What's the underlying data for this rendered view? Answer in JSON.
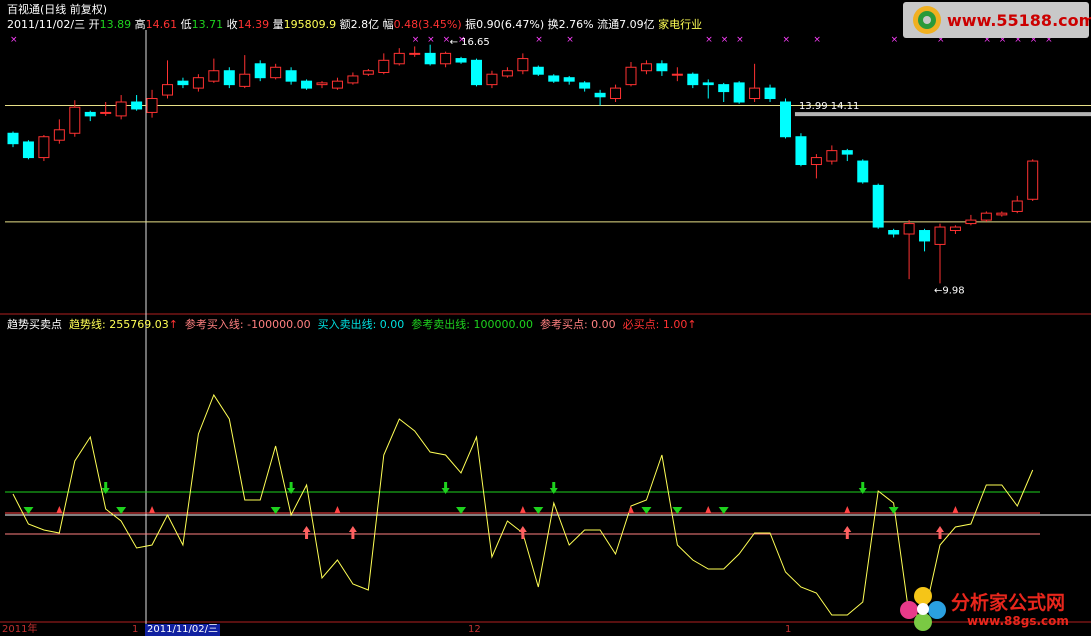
{
  "window": {
    "title": "百视通(日线 前复权)"
  },
  "quote": {
    "date": "2011/11/02/三",
    "open_label": "开",
    "open": "13.89",
    "high_label": "高",
    "high": "14.61",
    "low_label": "低",
    "low": "13.71",
    "close_label": "收",
    "close": "14.39",
    "vol_label": "量",
    "vol": "195809.9",
    "amount_label": "额",
    "amount": "2.8亿",
    "change_label": "幅",
    "change": "0.48(3.45%)",
    "amp_label": "振",
    "amp": "0.90(6.47%)",
    "turn_label": "换",
    "turn": "2.76%",
    "float_label": "流通",
    "float": "7.09亿",
    "industry": "家电行业"
  },
  "indicator": {
    "name": "趋势买卖点",
    "l1": "趋势线: 255769.03",
    "a1": "↑",
    "l2": "参考买入线: -100000.00",
    "l3": "买入卖出线: 0.00",
    "l4": "参考卖出线: 100000.00",
    "l5": "参考买点: 0.00",
    "l6": "必买点: 1.00",
    "a6": "↑"
  },
  "logos": {
    "top": "www.55188.com",
    "bottom_line1": "分析家公式网",
    "bottom_line2": "www.88gs.com"
  },
  "xaxis": {
    "labels": [
      "2011年",
      "1",
      "2011/11/02/三",
      "12",
      "1"
    ]
  },
  "colors": {
    "up": "#ff3232",
    "down": "#00ffff",
    "yellow": "#ffff55",
    "green": "#1ed21e",
    "red": "#ff4444",
    "pink": "#ff8080",
    "magenta": "#ff40ff"
  },
  "chart_data": {
    "type": "candlestick",
    "price_annotations": {
      "high_label": "16.65",
      "low_label": "9.98",
      "level_label": "13.99 14.11"
    },
    "price_ylim": [
      9.5,
      17.1
    ],
    "candles": [
      {
        "o": 14.3,
        "c": 14.0,
        "h": 14.35,
        "l": 13.9
      },
      {
        "o": 14.05,
        "c": 13.6,
        "h": 14.1,
        "l": 13.55
      },
      {
        "o": 13.6,
        "c": 14.2,
        "h": 14.25,
        "l": 13.5
      },
      {
        "o": 14.1,
        "c": 14.4,
        "h": 14.7,
        "l": 14.0
      },
      {
        "o": 14.3,
        "c": 15.05,
        "h": 15.25,
        "l": 14.2
      },
      {
        "o": 14.9,
        "c": 14.8,
        "h": 14.95,
        "l": 14.65
      },
      {
        "o": 14.9,
        "c": 14.9,
        "h": 15.2,
        "l": 14.8
      },
      {
        "o": 14.8,
        "c": 15.2,
        "h": 15.4,
        "l": 14.7
      },
      {
        "o": 15.2,
        "c": 15.0,
        "h": 15.4,
        "l": 14.95
      },
      {
        "o": 14.9,
        "c": 15.3,
        "h": 15.55,
        "l": 14.75
      },
      {
        "o": 15.4,
        "c": 15.7,
        "h": 16.4,
        "l": 15.3
      },
      {
        "o": 15.8,
        "c": 15.7,
        "h": 15.9,
        "l": 15.6
      },
      {
        "o": 15.6,
        "c": 15.9,
        "h": 16.0,
        "l": 15.5
      },
      {
        "o": 15.8,
        "c": 16.1,
        "h": 16.45,
        "l": 15.75
      },
      {
        "o": 16.1,
        "c": 15.7,
        "h": 16.2,
        "l": 15.6
      },
      {
        "o": 15.65,
        "c": 16.0,
        "h": 16.55,
        "l": 15.6
      },
      {
        "o": 16.3,
        "c": 15.9,
        "h": 16.4,
        "l": 15.8
      },
      {
        "o": 15.9,
        "c": 16.2,
        "h": 16.3,
        "l": 15.85
      },
      {
        "o": 16.1,
        "c": 15.8,
        "h": 16.2,
        "l": 15.7
      },
      {
        "o": 15.8,
        "c": 15.6,
        "h": 15.85,
        "l": 15.55
      },
      {
        "o": 15.7,
        "c": 15.75,
        "h": 15.8,
        "l": 15.6
      },
      {
        "o": 15.6,
        "c": 15.8,
        "h": 15.9,
        "l": 15.55
      },
      {
        "o": 15.75,
        "c": 15.95,
        "h": 16.05,
        "l": 15.7
      },
      {
        "o": 16.0,
        "c": 16.1,
        "h": 16.15,
        "l": 15.95
      },
      {
        "o": 16.05,
        "c": 16.4,
        "h": 16.6,
        "l": 16.0
      },
      {
        "o": 16.3,
        "c": 16.6,
        "h": 16.75,
        "l": 16.25
      },
      {
        "o": 16.6,
        "c": 16.6,
        "h": 16.8,
        "l": 16.5
      },
      {
        "o": 16.6,
        "c": 16.3,
        "h": 16.85,
        "l": 16.25
      },
      {
        "o": 16.3,
        "c": 16.6,
        "h": 16.65,
        "l": 16.2
      },
      {
        "o": 16.45,
        "c": 16.35,
        "h": 16.5,
        "l": 16.3
      },
      {
        "o": 16.4,
        "c": 15.7,
        "h": 16.45,
        "l": 15.65
      },
      {
        "o": 15.7,
        "c": 16.0,
        "h": 16.1,
        "l": 15.6
      },
      {
        "o": 15.95,
        "c": 16.1,
        "h": 16.2,
        "l": 15.9
      },
      {
        "o": 16.1,
        "c": 16.45,
        "h": 16.6,
        "l": 16.0
      },
      {
        "o": 16.2,
        "c": 16.0,
        "h": 16.25,
        "l": 15.95
      },
      {
        "o": 15.95,
        "c": 15.8,
        "h": 16.0,
        "l": 15.75
      },
      {
        "o": 15.9,
        "c": 15.8,
        "h": 15.95,
        "l": 15.7
      },
      {
        "o": 15.75,
        "c": 15.6,
        "h": 15.8,
        "l": 15.5
      },
      {
        "o": 15.45,
        "c": 15.35,
        "h": 15.55,
        "l": 15.1
      },
      {
        "o": 15.3,
        "c": 15.6,
        "h": 15.7,
        "l": 15.2
      },
      {
        "o": 15.7,
        "c": 16.2,
        "h": 16.35,
        "l": 15.65
      },
      {
        "o": 16.1,
        "c": 16.3,
        "h": 16.4,
        "l": 16.0
      },
      {
        "o": 16.3,
        "c": 16.1,
        "h": 16.4,
        "l": 15.95
      },
      {
        "o": 16.0,
        "c": 16.0,
        "h": 16.2,
        "l": 15.8
      },
      {
        "o": 16.0,
        "c": 15.7,
        "h": 16.05,
        "l": 15.6
      },
      {
        "o": 15.75,
        "c": 15.7,
        "h": 15.85,
        "l": 15.3
      },
      {
        "o": 15.7,
        "c": 15.5,
        "h": 15.75,
        "l": 15.2
      },
      {
        "o": 15.75,
        "c": 15.2,
        "h": 15.8,
        "l": 15.15
      },
      {
        "o": 15.3,
        "c": 15.6,
        "h": 16.3,
        "l": 15.2
      },
      {
        "o": 15.6,
        "c": 15.3,
        "h": 15.7,
        "l": 15.2
      },
      {
        "o": 15.2,
        "c": 14.2,
        "h": 15.3,
        "l": 14.15
      },
      {
        "o": 14.2,
        "c": 13.4,
        "h": 14.3,
        "l": 13.35
      },
      {
        "o": 13.4,
        "c": 13.6,
        "h": 13.7,
        "l": 13.0
      },
      {
        "o": 13.5,
        "c": 13.8,
        "h": 13.95,
        "l": 13.4
      },
      {
        "o": 13.8,
        "c": 13.7,
        "h": 13.85,
        "l": 13.5
      },
      {
        "o": 13.5,
        "c": 12.9,
        "h": 13.55,
        "l": 12.85
      },
      {
        "o": 12.8,
        "c": 11.6,
        "h": 12.85,
        "l": 11.55
      },
      {
        "o": 11.5,
        "c": 11.4,
        "h": 11.55,
        "l": 11.3
      },
      {
        "o": 11.4,
        "c": 11.7,
        "h": 11.8,
        "l": 10.1
      },
      {
        "o": 11.5,
        "c": 11.2,
        "h": 11.55,
        "l": 10.9
      },
      {
        "o": 11.1,
        "c": 11.6,
        "h": 11.7,
        "l": 9.98
      },
      {
        "o": 11.5,
        "c": 11.6,
        "h": 11.65,
        "l": 11.4
      },
      {
        "o": 11.7,
        "c": 11.8,
        "h": 11.95,
        "l": 11.65
      },
      {
        "o": 11.8,
        "c": 12.0,
        "h": 12.05,
        "l": 11.75
      },
      {
        "o": 11.95,
        "c": 12.0,
        "h": 12.05,
        "l": 11.9
      },
      {
        "o": 12.05,
        "c": 12.35,
        "h": 12.5,
        "l": 12.0
      },
      {
        "o": 12.4,
        "c": 13.5,
        "h": 13.55,
        "l": 12.35
      }
    ],
    "horizontal_levels": [
      15.1,
      11.75,
      14.85
    ],
    "indicator_series": {
      "name": "趋势线",
      "ylim": [
        -300000,
        500000
      ],
      "x_index_offset": 0,
      "values": [
        7,
        -3,
        -5,
        -6,
        18,
        26,
        2,
        -2,
        -11,
        -10,
        0,
        -10,
        27,
        40,
        32,
        5,
        5,
        23,
        0,
        10,
        -21,
        -15,
        -23,
        -25,
        20,
        32,
        28,
        21,
        20,
        14,
        26,
        -14,
        -2,
        -6,
        -24,
        4,
        -10,
        -5,
        -5,
        -13,
        3,
        5,
        20,
        -10,
        -15,
        -18,
        -18,
        -13,
        -6,
        -6,
        -19,
        -24,
        -26,
        -34,
        -45,
        -29,
        8,
        4,
        -34,
        -68,
        -10,
        -4,
        -3,
        10,
        10,
        3,
        15
      ]
    },
    "signals": {
      "down_arrows_idx": [
        6,
        18,
        28,
        35,
        55
      ],
      "up_arrows_idx": [
        19,
        22,
        33,
        54,
        60
      ],
      "green_tri_idx": [
        1,
        7,
        17,
        29,
        34,
        41,
        43,
        46,
        57
      ],
      "red_tri_idx": [
        3,
        9,
        21,
        33,
        40,
        45,
        54,
        61
      ]
    }
  }
}
